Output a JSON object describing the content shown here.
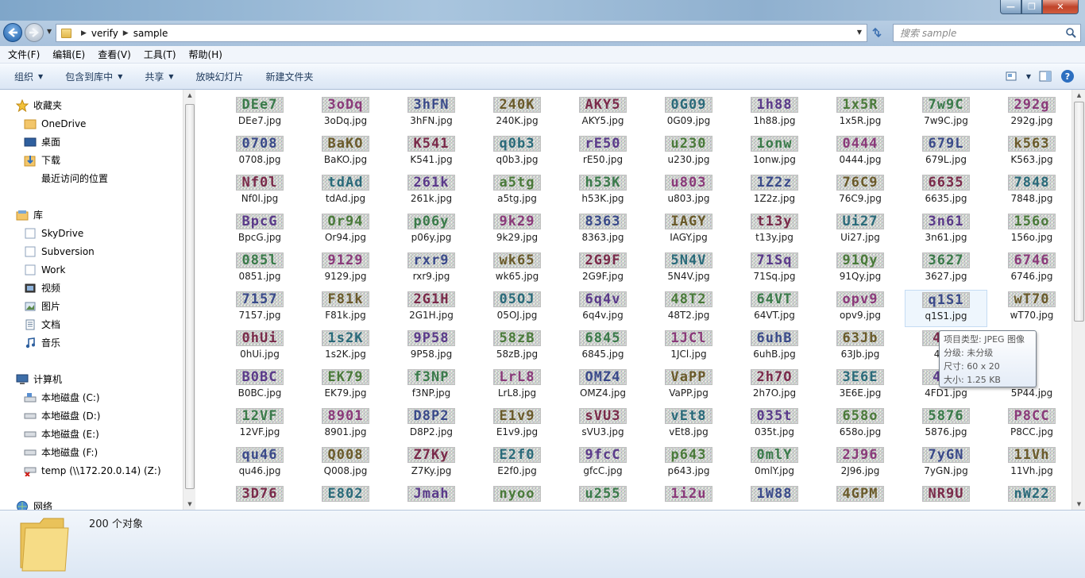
{
  "window": {
    "min_symbol": "—",
    "max_symbol": "❐",
    "close_symbol": "✕"
  },
  "nav": {
    "back_icon": "back-arrow-icon",
    "forward_icon": "forward-arrow-icon",
    "crumbs": [
      "verify",
      "sample"
    ]
  },
  "search": {
    "placeholder": "搜索 sample"
  },
  "menu": [
    "文件(F)",
    "编辑(E)",
    "查看(V)",
    "工具(T)",
    "帮助(H)"
  ],
  "toolbar": {
    "organize": "组织",
    "include": "包含到库中",
    "share": "共享",
    "slideshow": "放映幻灯片",
    "new_folder": "新建文件夹"
  },
  "sidebar": {
    "favorites": {
      "title": "收藏夹",
      "items": [
        "OneDrive",
        "桌面",
        "下载",
        "最近访问的位置"
      ]
    },
    "libraries": {
      "title": "库",
      "items": [
        "SkyDrive",
        "Subversion",
        "Work",
        "视频",
        "图片",
        "文档",
        "音乐"
      ]
    },
    "computer": {
      "title": "计算机",
      "items": [
        "本地磁盘 (C:)",
        "本地磁盘 (D:)",
        "本地磁盘 (E:)",
        "本地磁盘 (F:)",
        "temp (\\\\172.20.0.14) (Z:)"
      ]
    },
    "network": {
      "title": "网络"
    }
  },
  "files": [
    {
      "text": "DEe7",
      "name": "DEe7.jpg"
    },
    {
      "text": "3oDq",
      "name": "3oDq.jpg"
    },
    {
      "text": "3hFN",
      "name": "3hFN.jpg"
    },
    {
      "text": "240K",
      "name": "240K.jpg"
    },
    {
      "text": "AKY5",
      "name": "AKY5.jpg"
    },
    {
      "text": "0G09",
      "name": "0G09.jpg"
    },
    {
      "text": "1h88",
      "name": "1h88.jpg"
    },
    {
      "text": "1x5R",
      "name": "1x5R.jpg"
    },
    {
      "text": "7w9C",
      "name": "7w9C.jpg"
    },
    {
      "text": "292g",
      "name": "292g.jpg"
    },
    {
      "text": "0708",
      "name": "0708.jpg"
    },
    {
      "text": "BaKO",
      "name": "BaKO.jpg"
    },
    {
      "text": "K541",
      "name": "K541.jpg"
    },
    {
      "text": "q0b3",
      "name": "q0b3.jpg"
    },
    {
      "text": "rE50",
      "name": "rE50.jpg"
    },
    {
      "text": "u230",
      "name": "u230.jpg"
    },
    {
      "text": "1onw",
      "name": "1onw.jpg"
    },
    {
      "text": "0444",
      "name": "0444.jpg"
    },
    {
      "text": "679L",
      "name": "679L.jpg"
    },
    {
      "text": "k563",
      "name": "K563.jpg"
    },
    {
      "text": "Nf0l",
      "name": "Nf0l.jpg"
    },
    {
      "text": "tdAd",
      "name": "tdAd.jpg"
    },
    {
      "text": "261k",
      "name": "261k.jpg"
    },
    {
      "text": "a5tg",
      "name": "a5tg.jpg"
    },
    {
      "text": "h53K",
      "name": "h53K.jpg"
    },
    {
      "text": "u803",
      "name": "u803.jpg"
    },
    {
      "text": "1Z2z",
      "name": "1Z2z.jpg"
    },
    {
      "text": "76C9",
      "name": "76C9.jpg"
    },
    {
      "text": "6635",
      "name": "6635.jpg"
    },
    {
      "text": "7848",
      "name": "7848.jpg"
    },
    {
      "text": "BpcG",
      "name": "BpcG.jpg"
    },
    {
      "text": "Or94",
      "name": "Or94.jpg"
    },
    {
      "text": "p06y",
      "name": "p06y.jpg"
    },
    {
      "text": "9k29",
      "name": "9k29.jpg"
    },
    {
      "text": "8363",
      "name": "8363.jpg"
    },
    {
      "text": "IAGY",
      "name": "IAGY.jpg"
    },
    {
      "text": "t13y",
      "name": "t13y.jpg"
    },
    {
      "text": "Ui27",
      "name": "Ui27.jpg"
    },
    {
      "text": "3n61",
      "name": "3n61.jpg"
    },
    {
      "text": "156o",
      "name": "156o.jpg"
    },
    {
      "text": "085l",
      "name": "0851.jpg"
    },
    {
      "text": "9129",
      "name": "9129.jpg"
    },
    {
      "text": "rxr9",
      "name": "rxr9.jpg"
    },
    {
      "text": "wk65",
      "name": "wk65.jpg"
    },
    {
      "text": "2G9F",
      "name": "2G9F.jpg"
    },
    {
      "text": "5N4V",
      "name": "5N4V.jpg"
    },
    {
      "text": "71Sq",
      "name": "71Sq.jpg"
    },
    {
      "text": "91Qy",
      "name": "91Qy.jpg"
    },
    {
      "text": "3627",
      "name": "3627.jpg"
    },
    {
      "text": "6746",
      "name": "6746.jpg"
    },
    {
      "text": "7157",
      "name": "7157.jpg"
    },
    {
      "text": "F81k",
      "name": "F81k.jpg"
    },
    {
      "text": "2G1H",
      "name": "2G1H.jpg"
    },
    {
      "text": "05OJ",
      "name": "05OJ.jpg"
    },
    {
      "text": "6q4v",
      "name": "6q4v.jpg"
    },
    {
      "text": "48T2",
      "name": "48T2.jpg"
    },
    {
      "text": "64VT",
      "name": "64VT.jpg"
    },
    {
      "text": "opv9",
      "name": "opv9.jpg"
    },
    {
      "text": "q1S1",
      "name": "q1S1.jpg"
    },
    {
      "text": "wT70",
      "name": "wT70.jpg"
    },
    {
      "text": "0hUi",
      "name": "0hUi.jpg"
    },
    {
      "text": "1s2K",
      "name": "1s2K.jpg"
    },
    {
      "text": "9P58",
      "name": "9P58.jpg"
    },
    {
      "text": "58zB",
      "name": "58zB.jpg"
    },
    {
      "text": "6845",
      "name": "6845.jpg"
    },
    {
      "text": "1JCl",
      "name": "1JCl.jpg"
    },
    {
      "text": "6uhB",
      "name": "6uhB.jpg"
    },
    {
      "text": "63Jb",
      "name": "63Jb.jpg"
    },
    {
      "text": "466",
      "name": "4660"
    },
    {
      "text": "",
      "name": ""
    },
    {
      "text": "B0BC",
      "name": "B0BC.jpg"
    },
    {
      "text": "EK79",
      "name": "EK79.jpg"
    },
    {
      "text": "f3NP",
      "name": "f3NP.jpg"
    },
    {
      "text": "LrL8",
      "name": "LrL8.jpg"
    },
    {
      "text": "OMZ4",
      "name": "OMZ4.jpg"
    },
    {
      "text": "VaPP",
      "name": "VaPP.jpg"
    },
    {
      "text": "2h7O",
      "name": "2h7O.jpg"
    },
    {
      "text": "3E6E",
      "name": "3E6E.jpg"
    },
    {
      "text": "4FD",
      "name": "4FD1.jpg"
    },
    {
      "text": "",
      "name": "5P44.jpg"
    },
    {
      "text": "12VF",
      "name": "12VF.jpg"
    },
    {
      "text": "8901",
      "name": "8901.jpg"
    },
    {
      "text": "D8P2",
      "name": "D8P2.jpg"
    },
    {
      "text": "E1v9",
      "name": "E1v9.jpg"
    },
    {
      "text": "sVU3",
      "name": "sVU3.jpg"
    },
    {
      "text": "vEt8",
      "name": "vEt8.jpg"
    },
    {
      "text": "035t",
      "name": "035t.jpg"
    },
    {
      "text": "658o",
      "name": "658o.jpg"
    },
    {
      "text": "5876",
      "name": "5876.jpg"
    },
    {
      "text": "P8CC",
      "name": "P8CC.jpg"
    },
    {
      "text": "qu46",
      "name": "qu46.jpg"
    },
    {
      "text": "Q008",
      "name": "Q008.jpg"
    },
    {
      "text": "Z7Ky",
      "name": "Z7Ky.jpg"
    },
    {
      "text": "E2f0",
      "name": "E2f0.jpg"
    },
    {
      "text": "9fcC",
      "name": "gfcC.jpg"
    },
    {
      "text": "p643",
      "name": "p643.jpg"
    },
    {
      "text": "0mlY",
      "name": "0mlY.jpg"
    },
    {
      "text": "2J96",
      "name": "2J96.jpg"
    },
    {
      "text": "7yGN",
      "name": "7yGN.jpg"
    },
    {
      "text": "11Vh",
      "name": "11Vh.jpg"
    },
    {
      "text": "3D76",
      "name": ""
    },
    {
      "text": "E802",
      "name": ""
    },
    {
      "text": "Jmah",
      "name": ""
    },
    {
      "text": "nyoo",
      "name": ""
    },
    {
      "text": "u255",
      "name": ""
    },
    {
      "text": "1i2u",
      "name": ""
    },
    {
      "text": "1W88",
      "name": ""
    },
    {
      "text": "4GPM",
      "name": ""
    },
    {
      "text": "NR9U",
      "name": ""
    },
    {
      "text": "nW22",
      "name": ""
    }
  ],
  "selected_index": 58,
  "tooltip": {
    "type": "项目类型: JPEG 图像",
    "rating": "分级: 未分级",
    "dimensions": "尺寸: 60 x 20",
    "size": "大小: 1.25 KB"
  },
  "status": {
    "count": "200 个对象"
  },
  "colors": {
    "char_palette": [
      "#3a7a4a",
      "#8a3a7a",
      "#3a4a8a",
      "#6a5a2a",
      "#7a2a4a",
      "#2a6a7a",
      "#5a3a8a",
      "#4a7a3a"
    ]
  }
}
